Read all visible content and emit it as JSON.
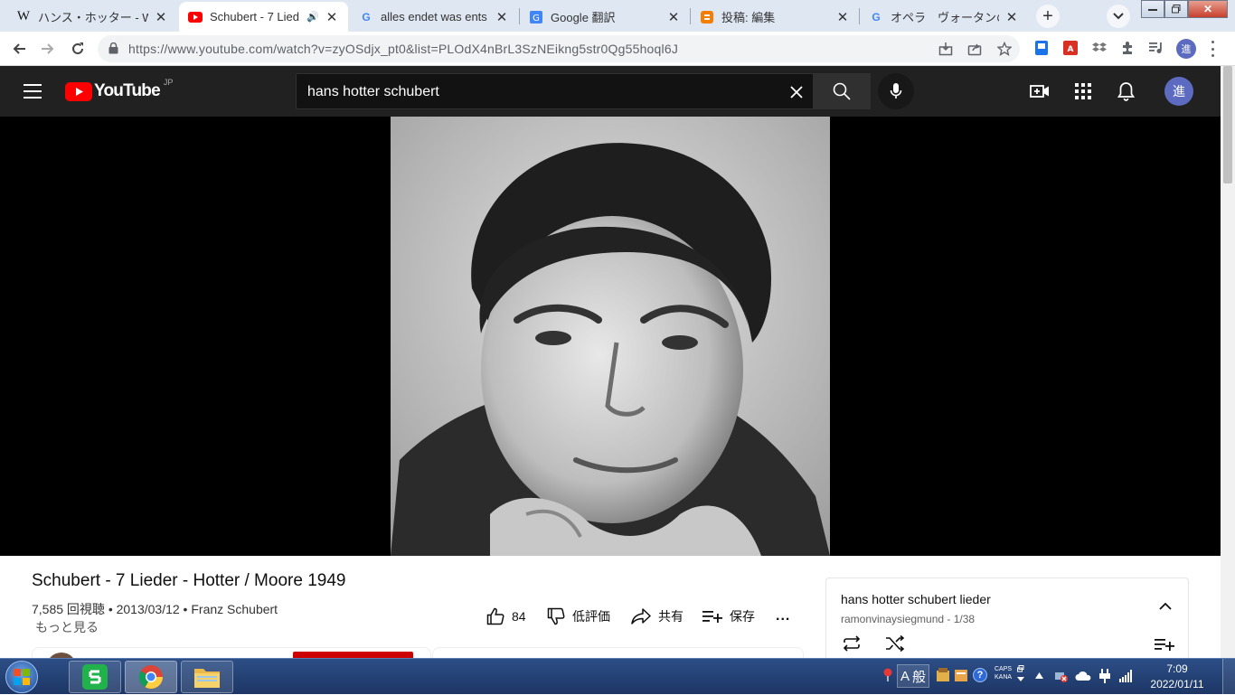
{
  "browser": {
    "tabs": [
      {
        "title": "ハンス・ホッター - W",
        "favicon": "wikipedia-icon"
      },
      {
        "title": "Schubert - 7 Lied",
        "favicon": "youtube-icon",
        "audio": true
      },
      {
        "title": "alles endet was ents",
        "favicon": "google-icon"
      },
      {
        "title": "Google 翻訳",
        "favicon": "google-translate-icon"
      },
      {
        "title": "投稿: 編集",
        "favicon": "blogger-icon"
      },
      {
        "title": "オペラ　ヴォータンの",
        "favicon": "google-icon"
      }
    ],
    "new_tab_symbol": "+",
    "url": "https://www.youtube.com/watch?v=zyOSdjx_pt0&list=PLOdX4nBrL3SzNEikng5str0Qg55hoql6J",
    "profile_initial": "進"
  },
  "youtube": {
    "logo_text": "YouTube",
    "region": "JP",
    "search_query": "hans hotter schubert",
    "avatar_initial": "進"
  },
  "video": {
    "title": "Schubert - 7 Lieder - Hotter / Moore 1949",
    "meta": "7,585 回視聴 • 2013/03/12 • Franz Schubert",
    "more": "もっと見る",
    "likes": "84",
    "dislike_label": "低評価",
    "share_label": "共有",
    "save_label": "保存",
    "more_actions": "..."
  },
  "playlist": {
    "title": "hans hotter schubert lieder",
    "subtitle": "ramonvinaysiegmund - 1/38"
  },
  "taskbar": {
    "ime_mode": "A",
    "ime_label": "般",
    "caps": "CAPS",
    "kana": "KANA",
    "time": "7:09",
    "date": "2022/01/11"
  },
  "colors": {
    "youtube_red": "#ff0000",
    "header_bg": "#212121",
    "avatar": "#5c6bc0"
  }
}
